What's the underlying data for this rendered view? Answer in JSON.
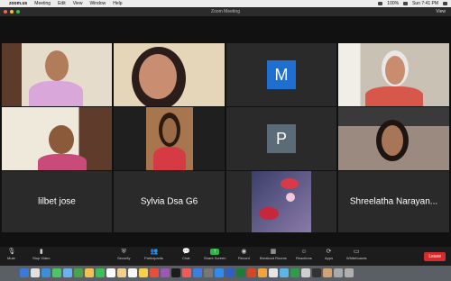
{
  "menubar": {
    "app": "zoom.us",
    "items": [
      "Meeting",
      "Edit",
      "View",
      "Window",
      "Help"
    ],
    "battery": "100%",
    "clock": "Sun 7:41 PM"
  },
  "window": {
    "title": "Zoom Meeting",
    "view_label": "View"
  },
  "participants": [
    {
      "name": "",
      "type": "video"
    },
    {
      "name": "",
      "type": "video"
    },
    {
      "name": "M",
      "type": "initial"
    },
    {
      "name": "",
      "type": "video"
    },
    {
      "name": "",
      "type": "video"
    },
    {
      "name": "",
      "type": "video"
    },
    {
      "name": "P",
      "type": "initial"
    },
    {
      "name": "",
      "type": "video"
    },
    {
      "name": "lilbet jose",
      "type": "name"
    },
    {
      "name": "Sylvia Dsa G6",
      "type": "name"
    },
    {
      "name": "",
      "type": "image"
    },
    {
      "name": "Shreelatha Narayan...",
      "type": "name"
    }
  ],
  "toolbar": {
    "mute": "Mute",
    "video": "Stop Video",
    "security": "Security",
    "participants": "Participants",
    "participants_count": "12",
    "chat": "Chat",
    "share": "Share Screen",
    "record": "Record",
    "breakout": "Breakout Rooms",
    "reactions": "Reactions",
    "apps": "Apps",
    "whiteboards": "Whiteboards",
    "leave": "Leave"
  },
  "colors": {
    "active_speaker": "#3ad13a",
    "initial_m": "#1f6fd1",
    "initial_p": "#5b6b78",
    "leave": "#d62c2c"
  }
}
